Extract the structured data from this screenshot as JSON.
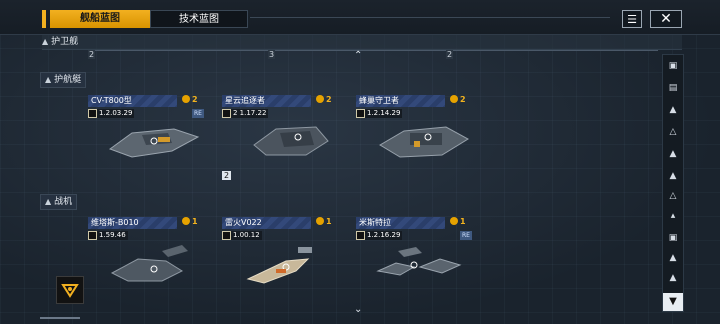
{
  "tabs": [
    {
      "label": "舰船蓝图",
      "active": true
    },
    {
      "label": "技术蓝图",
      "active": false
    }
  ],
  "topbar": {
    "list_icon": "document-list-icon",
    "close_icon": "close-icon"
  },
  "sections": {
    "escort": {
      "label": "护卫舰",
      "icon": "triangle-icon"
    },
    "corvette": {
      "label": "护航艇",
      "icon": "corvette-icon"
    },
    "fighter": {
      "label": "战机",
      "icon": "fighter-icon"
    }
  },
  "ruler_marks": [
    "2",
    "3",
    "2"
  ],
  "corvettes": [
    {
      "name": "CV-T800型",
      "count": "2",
      "stat": "1.2.03.29",
      "re": "RE"
    },
    {
      "name": "星云追逐者",
      "count": "2",
      "stat": "2 1.17.22",
      "re": "",
      "tier": "2"
    },
    {
      "name": "蜂巢守卫者",
      "count": "2",
      "stat": "1.2.14.29",
      "re": ""
    }
  ],
  "fighters": [
    {
      "name": "维塔斯-B010",
      "count": "1",
      "stat": "1.59.46",
      "re": ""
    },
    {
      "name": "雷火V022",
      "count": "1",
      "stat": "1.00.12",
      "re": ""
    },
    {
      "name": "米斯特拉",
      "count": "1",
      "stat": "1.2.16.29",
      "re": "RE"
    }
  ],
  "sidebar": [
    "ship-icon",
    "carrier-icon",
    "cruiser-icon",
    "destroyer-icon",
    "frigate-icon",
    "escort-icon",
    "corvette-icon",
    "fighter-icon",
    "drone-icon",
    "support-icon",
    "misc-icon"
  ],
  "filter_icon": "filter-icon",
  "colors": {
    "accent": "#f2b020",
    "card_header": "#2a3e6a",
    "background": "#1c2631"
  }
}
